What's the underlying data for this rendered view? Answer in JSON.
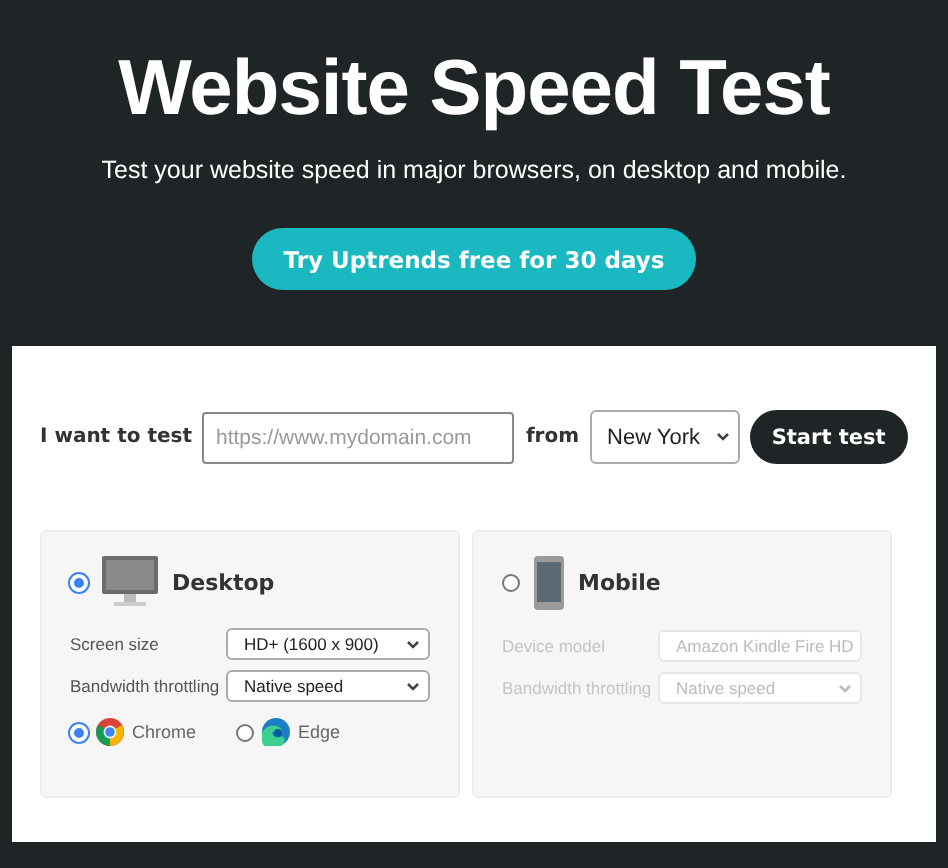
{
  "hero": {
    "title": "Website Speed Test",
    "subtitle": "Test your website speed in major browsers, on desktop and mobile.",
    "cta": "Try Uptrends free for 30 days"
  },
  "form": {
    "label": "I want to test",
    "url_placeholder": "https://www.mydomain.com",
    "from_label": "from",
    "location": "New York",
    "submit": "Start test"
  },
  "devices": [
    {
      "kind": "desktop",
      "label": "Desktop",
      "selected": true,
      "settings": [
        {
          "label": "Screen size",
          "value": "HD+ (1600 x 900)"
        },
        {
          "label": "Bandwidth throttling",
          "value": "Native speed"
        }
      ],
      "browsers": [
        {
          "kind": "chrome",
          "label": "Chrome",
          "selected": true
        },
        {
          "kind": "edge",
          "label": "Edge",
          "selected": false
        }
      ]
    },
    {
      "kind": "mobile",
      "label": "Mobile",
      "selected": false,
      "settings": [
        {
          "label": "Device model",
          "value": "Amazon Kindle Fire HD"
        },
        {
          "label": "Bandwidth throttling",
          "value": "Native speed"
        }
      ]
    }
  ]
}
